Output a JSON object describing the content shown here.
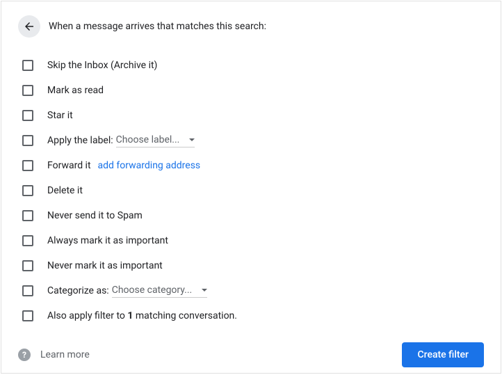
{
  "header": {
    "title": "When a message arrives that matches this search:"
  },
  "options": {
    "skip_inbox": "Skip the Inbox (Archive it)",
    "mark_read": "Mark as read",
    "star": "Star it",
    "apply_label": "Apply the label: ",
    "label_dropdown": "Choose label...",
    "forward": "Forward it",
    "forward_link": "add forwarding address",
    "delete": "Delete it",
    "never_spam": "Never send it to Spam",
    "always_important": "Always mark it as important",
    "never_important": "Never mark it as important",
    "categorize": "Categorize as: ",
    "category_dropdown": "Choose category...",
    "also_apply_prefix": "Also apply filter to ",
    "also_apply_count": "1",
    "also_apply_suffix": " matching conversation."
  },
  "footer": {
    "help_symbol": "?",
    "learn_more": "Learn more",
    "create": "Create filter"
  }
}
